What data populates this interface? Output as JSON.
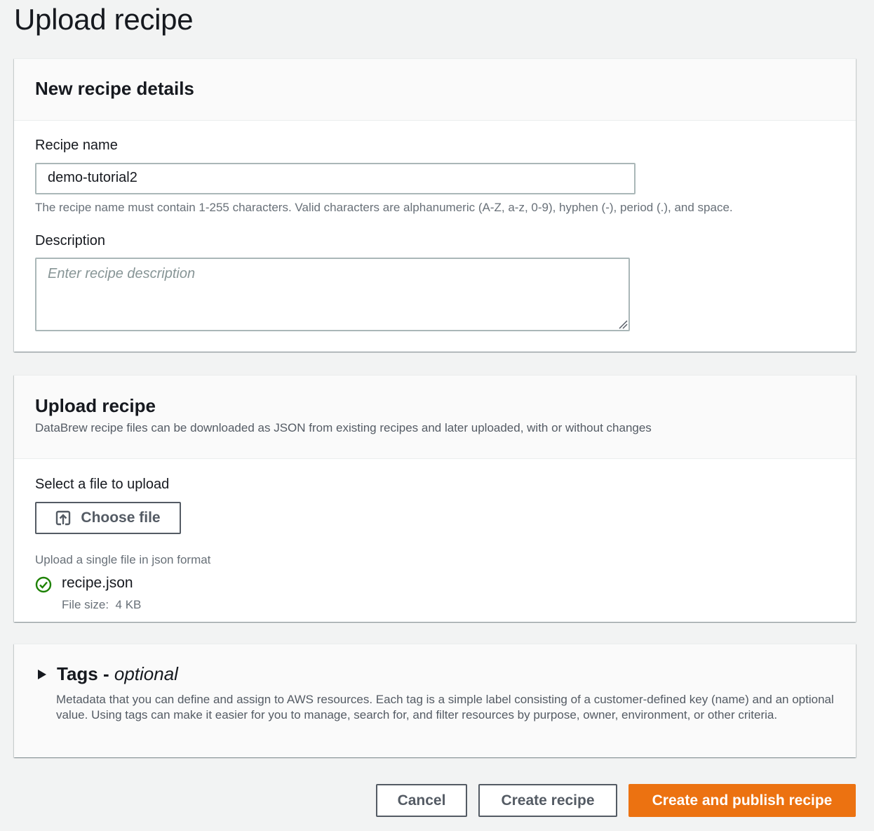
{
  "page": {
    "title": "Upload recipe"
  },
  "details": {
    "heading": "New recipe details",
    "name_label": "Recipe name",
    "name_value": "demo-tutorial2",
    "name_hint": "The recipe name must contain 1-255 characters. Valid characters are alphanumeric (A-Z, a-z, 0-9), hyphen (-), period (.), and space.",
    "description_label": "Description",
    "description_placeholder": "Enter recipe description"
  },
  "upload": {
    "heading": "Upload recipe",
    "description": "DataBrew recipe files can be downloaded as JSON from existing recipes and later uploaded, with or without changes",
    "select_label": "Select a file to upload",
    "choose_button": "Choose file",
    "hint": "Upload a single file in json format",
    "file": {
      "name": "recipe.json",
      "size_label": "File size:",
      "size_value": "4 KB",
      "status_icon": "success-check-icon"
    }
  },
  "tags": {
    "title": "Tags -",
    "title_suffix": "optional",
    "description": "Metadata that you can define and assign to AWS resources. Each tag is a simple label consisting of a customer-defined key (name) and an optional value. Using tags can make it easier for you to manage, search for, and filter resources by purpose, owner, environment, or other criteria."
  },
  "footer": {
    "cancel": "Cancel",
    "create": "Create recipe",
    "create_publish": "Create and publish recipe"
  },
  "colors": {
    "primary": "#ec7211",
    "success": "#1d8102",
    "background": "#f2f3f3"
  }
}
